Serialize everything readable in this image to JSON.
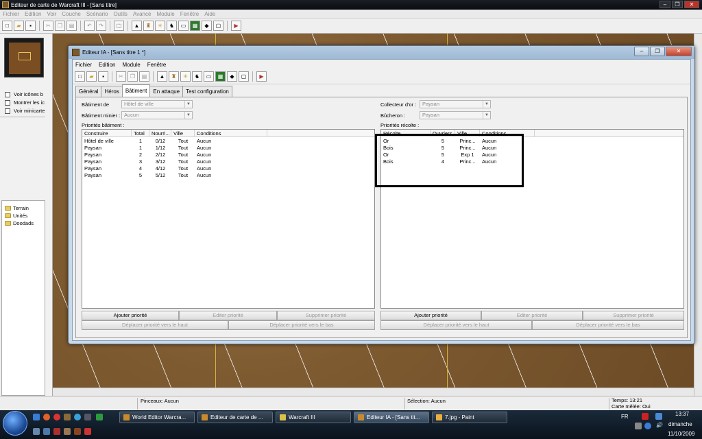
{
  "app": {
    "title": "Editeur de carte de Warcraft III - [Sans titre]",
    "menu": [
      "Fichier",
      "Edition",
      "Voir",
      "Couche",
      "Scénario",
      "Outils",
      "Avancé",
      "Module",
      "Fenêtre",
      "Aide"
    ]
  },
  "left_panel": {
    "checkboxes": [
      "Voir icônes b",
      "Montrer les ic",
      "Voir minicarte"
    ],
    "tree": [
      "Terrain",
      "Unités",
      "Doodads"
    ]
  },
  "status": {
    "brushes": "Pinceaux: Aucun",
    "selection": "Sélection: Aucun",
    "time": "Temps: 13:21",
    "melee": "Carte mêlée: Oui"
  },
  "taskbar": {
    "buttons": [
      "World Editor Warcra...",
      "Editeur de carte de ...",
      "Warcraft III",
      "Editeur IA - [Sans tit...",
      "7.jpg - Paint"
    ],
    "lang": "FR",
    "clock_time": "13:37",
    "clock_day": "dimanche",
    "clock_date": "11/10/2009"
  },
  "ia_window": {
    "title": "Editeur IA - [Sans titre 1 *]",
    "menu": [
      "Fichier",
      "Edition",
      "Module",
      "Fenêtre"
    ],
    "tabs": [
      "Général",
      "Héros",
      "Bâtiment",
      "En attaque",
      "Test configuration"
    ],
    "active_tab": 2,
    "form": {
      "batiment_de_label": "Bâtiment de",
      "batiment_de_value": "Hôtel de ville",
      "batiment_minier_label": "Bâtiment minier :",
      "batiment_minier_value": "Aucun",
      "collecteur_label": "Collecteur d'or :",
      "collecteur_value": "Paysan",
      "bucheron_label": "Bûcheron :",
      "bucheron_value": "Paysan"
    },
    "priorites_batiment": {
      "label": "Priorités bâtiment :",
      "columns": [
        "Construire",
        "Total",
        "Nourri...",
        "Ville",
        "Conditions"
      ],
      "rows": [
        [
          "Hôtel de ville",
          "1",
          "0/12",
          "Tout",
          "Aucun"
        ],
        [
          "Paysan",
          "1",
          "1/12",
          "Tout",
          "Aucun"
        ],
        [
          "Paysan",
          "2",
          "2/12",
          "Tout",
          "Aucun"
        ],
        [
          "Paysan",
          "3",
          "3/12",
          "Tout",
          "Aucun"
        ],
        [
          "Paysan",
          "4",
          "4/12",
          "Tout",
          "Aucun"
        ],
        [
          "Paysan",
          "5",
          "5/12",
          "Tout",
          "Aucun"
        ]
      ]
    },
    "priorites_recolte": {
      "label": "Priorités récolte :",
      "columns": [
        "Récolte",
        "Ouvriers",
        "Ville",
        "Conditions"
      ],
      "rows": [
        [
          "Or",
          "5",
          "Princ...",
          "Aucun"
        ],
        [
          "Bois",
          "5",
          "Princ...",
          "Aucun"
        ],
        [
          "Or",
          "5",
          "Exp 1",
          "Aucun"
        ],
        [
          "Bois",
          "4",
          "Princ...",
          "Aucun"
        ]
      ]
    },
    "buttons": {
      "add": "Ajouter priorité",
      "edit": "Editer priorité",
      "delete": "Supprimer priorité",
      "move_up": "Déplacer priorité vers le haut",
      "move_down": "Déplacer priorité vers le bas"
    }
  }
}
